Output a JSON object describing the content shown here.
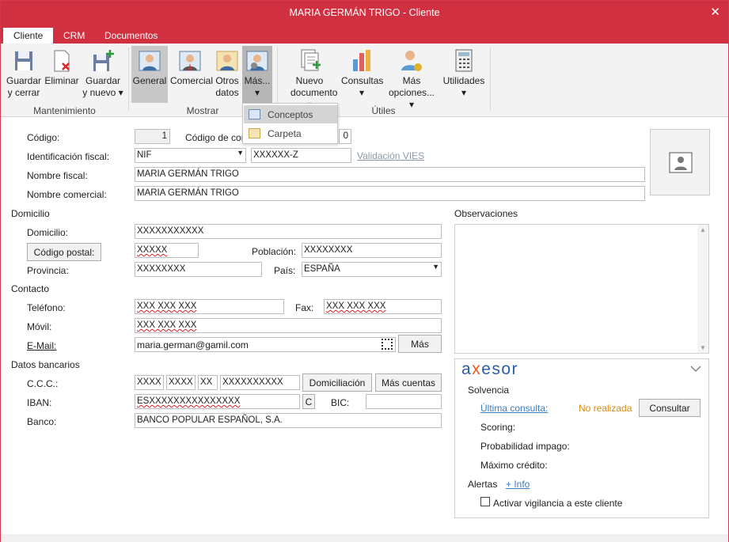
{
  "window": {
    "title": "MARIA GERMÁN TRIGO - Cliente",
    "close": "✕"
  },
  "tabs": [
    "Cliente",
    "CRM",
    "Documentos"
  ],
  "ribbon": {
    "buttons": {
      "guardar": [
        "Guardar",
        "y cerrar"
      ],
      "eliminar": [
        "Eliminar"
      ],
      "guardar_nuevo": [
        "Guardar",
        "y nuevo ▾"
      ],
      "general": [
        "General"
      ],
      "comercial": [
        "Comercial"
      ],
      "otros": [
        "Otros",
        "datos"
      ],
      "mas": [
        "Más...",
        "▾"
      ],
      "nuevo": [
        "Nuevo",
        "documento ▾"
      ],
      "consultas": [
        "Consultas",
        "▾"
      ],
      "mas_opciones": [
        "Más",
        "opciones... ▾"
      ],
      "utilidades": [
        "Utilidades",
        "▾"
      ]
    },
    "groups": {
      "mantenimiento": "Mantenimiento",
      "mostrar": "Mostrar",
      "utiles": "Útiles"
    },
    "dropdown": [
      "Conceptos",
      "Carpeta"
    ]
  },
  "form": {
    "codigo_label": "Código:",
    "codigo_value": "1",
    "codigo_con_label": "Código de con",
    "codigo_con_value": "0",
    "idfiscal_label": "Identificación fiscal:",
    "idfiscal_type": "NIF",
    "idfiscal_value": "XXXXXX-Z",
    "vies_link": "Validación VIES",
    "nombre_fiscal_label": "Nombre fiscal:",
    "nombre_fiscal": "MARIA GERMÁN TRIGO",
    "nombre_comercial_label": "Nombre comercial:",
    "nombre_comercial": "MARIA GERMÁN TRIGO",
    "domicilio_section": "Domicilio",
    "domicilio_label": "Domicilio:",
    "domicilio": "XXXXXXXXXXX",
    "cp_button": "Código postal:",
    "cp": "XXXXX",
    "poblacion_label": "Población:",
    "poblacion": "XXXXXXXX",
    "provincia_label": "Provincia:",
    "provincia": "XXXXXXXX",
    "pais_label": "País:",
    "pais": "ESPAÑA",
    "contacto_section": "Contacto",
    "telefono_label": "Teléfono:",
    "telefono": "XXX XXX XXX",
    "fax_label": "Fax:",
    "fax": "XXX XXX XXX",
    "movil_label": "Móvil:",
    "movil": "XXX XXX XXX",
    "email_label": "E-Mail:",
    "email": "maria.german@gamil.com",
    "mas_button": "Más",
    "bancarios_section": "Datos bancarios",
    "ccc_label": "C.C.C.:",
    "ccc": [
      "XXXX",
      "XXXX",
      "XX",
      "XXXXXXXXXX"
    ],
    "domiciliacion_button": "Domiciliación",
    "mas_cuentas_button": "Más cuentas",
    "iban_label": "IBAN:",
    "iban": "ESXXXXXXXXXXXXXXX",
    "iban_c": "C",
    "bic_label": "BIC:",
    "bic": "",
    "banco_label": "Banco:",
    "banco": "BANCO POPULAR ESPAÑOL, S.A.",
    "observaciones_label": "Observaciones"
  },
  "axesor": {
    "logo": "axesor",
    "solvencia": "Solvencia",
    "ultima_consulta": "Última consulta:",
    "estado": "No realizada",
    "consultar": "Consultar",
    "scoring": "Scoring:",
    "probabilidad": "Probabilidad impago:",
    "maximo": "Máximo crédito:",
    "alertas": "Alertas",
    "info": "+ Info",
    "vigilancia": "Activar vigilancia a este cliente"
  },
  "colors": {
    "accent": "#d0303f",
    "link": "#3a7bbf",
    "warning": "#d08c12"
  }
}
